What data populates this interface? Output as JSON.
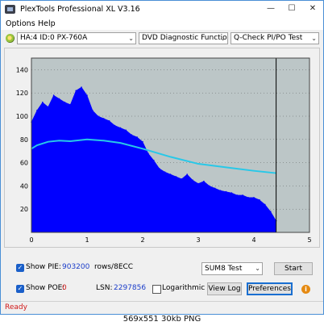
{
  "window": {
    "title": "PlexTools Professional XL V3.16"
  },
  "menu": {
    "items": [
      "Options",
      "Help"
    ]
  },
  "toolbar": {
    "drive": "HA:4 ID:0  PX-760A",
    "function": "DVD Diagnostic Functions",
    "test": "Q-Check PI/PO Test"
  },
  "chart_data": {
    "type": "area",
    "xlim": [
      0,
      5
    ],
    "ylim": [
      0,
      150
    ],
    "x_ticks": [
      "0",
      "1",
      "2",
      "3",
      "4",
      "5"
    ],
    "y_ticks": [
      "20",
      "40",
      "60",
      "80",
      "100",
      "120",
      "140"
    ],
    "grid": true,
    "end_marker_x": 4.4,
    "colors": {
      "bars": "#0000ff",
      "speed": "#28c8e8",
      "background": "#bcc6c7"
    },
    "series": [
      {
        "kind": "area",
        "x": [
          0.0,
          0.1,
          0.2,
          0.3,
          0.4,
          0.5,
          0.6,
          0.7,
          0.8,
          0.9,
          1.0,
          1.1,
          1.2,
          1.3,
          1.4,
          1.5,
          1.6,
          1.7,
          1.8,
          1.9,
          2.0,
          2.1,
          2.2,
          2.3,
          2.4,
          2.5,
          2.6,
          2.7,
          2.8,
          2.9,
          3.0,
          3.1,
          3.2,
          3.3,
          3.4,
          3.5,
          3.6,
          3.7,
          3.8,
          3.9,
          4.0,
          4.1,
          4.2,
          4.3,
          4.4
        ],
        "values": [
          95,
          105,
          112,
          108,
          118,
          115,
          112,
          110,
          122,
          125,
          118,
          105,
          100,
          98,
          96,
          92,
          90,
          88,
          84,
          82,
          78,
          68,
          62,
          55,
          52,
          50,
          48,
          46,
          50,
          45,
          42,
          44,
          40,
          38,
          36,
          35,
          34,
          32,
          32,
          30,
          30,
          28,
          24,
          18,
          10
        ]
      },
      {
        "kind": "line",
        "x": [
          0.0,
          0.1,
          0.3,
          0.5,
          0.7,
          1.0,
          1.3,
          1.6,
          2.0,
          2.5,
          3.0,
          3.5,
          4.0,
          4.4
        ],
        "values": [
          72,
          75,
          78,
          79,
          78.5,
          80,
          79,
          77,
          72,
          65,
          59,
          56,
          53,
          51
        ]
      }
    ]
  },
  "controls": {
    "show_pie_label": "Show PIE:",
    "pie_value": "903200",
    "rows_label": "rows/8ECC",
    "show_poe_label": "Show POE:",
    "poe_value": "0",
    "lsn_label": "LSN:",
    "lsn_value": "2297856",
    "logarithmic_label": "Logarithmic",
    "sum_select": "SUM8 Test",
    "start_label": "Start",
    "view_log_label": "View Log",
    "preferences_label": "Preferences",
    "check_mark": "✓"
  },
  "status": {
    "text": "Ready"
  },
  "caption": "569x551  30kb  PNG"
}
